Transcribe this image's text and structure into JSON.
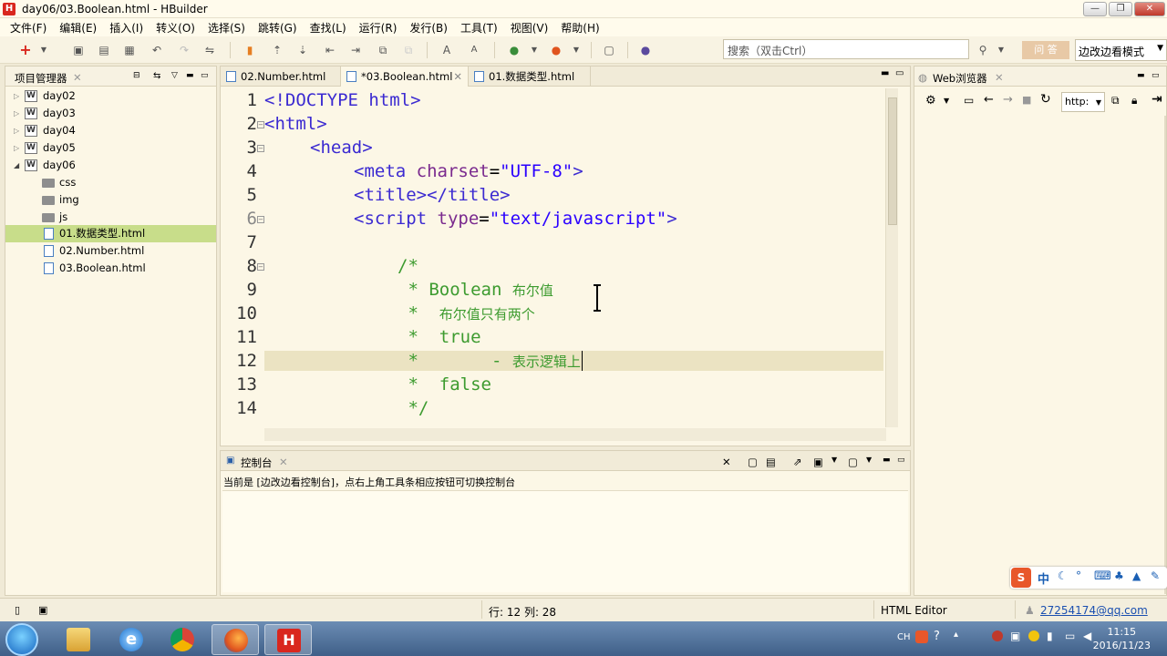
{
  "window": {
    "title": "day06/03.Boolean.html - HBuilder",
    "logo": "H",
    "controls": {
      "minimize": "—",
      "restore": "❐",
      "close": "✕"
    }
  },
  "menu": [
    "文件(F)",
    "编辑(E)",
    "插入(I)",
    "转义(O)",
    "选择(S)",
    "跳转(G)",
    "查找(L)",
    "运行(R)",
    "发行(B)",
    "工具(T)",
    "视图(V)",
    "帮助(H)"
  ],
  "toolbar": {
    "search_placeholder": "搜索（双击Ctrl）",
    "ask_label": "问 答",
    "mode_label": "边改边看模式"
  },
  "project_panel": {
    "title": "项目管理器",
    "items": [
      {
        "label": "day02",
        "type": "project"
      },
      {
        "label": "day03",
        "type": "project"
      },
      {
        "label": "day04",
        "type": "project"
      },
      {
        "label": "day05",
        "type": "project"
      },
      {
        "label": "day06",
        "type": "project"
      },
      {
        "label": "css",
        "type": "folder"
      },
      {
        "label": "img",
        "type": "folder"
      },
      {
        "label": "js",
        "type": "folder"
      },
      {
        "label": "01.数据类型.html",
        "type": "file",
        "selected": true
      },
      {
        "label": "02.Number.html",
        "type": "file"
      },
      {
        "label": "03.Boolean.html",
        "type": "file"
      }
    ]
  },
  "editor": {
    "tabs": [
      {
        "label": "02.Number.html",
        "active": false
      },
      {
        "label": "*03.Boolean.html",
        "active": true
      },
      {
        "label": "01.数据类型.html",
        "active": false
      }
    ],
    "line_numbers": [
      "1",
      "2",
      "3",
      "4",
      "5",
      "6",
      "7",
      "8",
      "9",
      "10",
      "11",
      "12",
      "13",
      "14"
    ],
    "code": {
      "l1": "<!DOCTYPE html>",
      "l2": "<html>",
      "l3": "<head>",
      "l4_tag": "<meta ",
      "l4_attr": "charset",
      "l4_eq": "=",
      "l4_val": "\"UTF-8\"",
      "l4_end": ">",
      "l5": "<title></title>",
      "l6_tag": "<script ",
      "l6_attr": "type",
      "l6_eq": "=",
      "l6_val": "\"text/javascript\"",
      "l6_end": ">",
      "l8": "/*",
      "l9_star": " * Boolean ",
      "l9_cn": "布尔值",
      "l10_star": " *  ",
      "l10_cn": "布尔值只有两个",
      "l11": " *  true",
      "l12_star": " *       - ",
      "l12_cn": "表示逻辑上",
      "l13": " *  false",
      "l14": " */"
    }
  },
  "console": {
    "title": "控制台",
    "message": "当前是 [边改边看控制台]，点右上角工具条相应按钮可切换控制台"
  },
  "browser_panel": {
    "title": "Web浏览器",
    "url": "http:"
  },
  "status": {
    "position": "行: 12 列: 28",
    "editor_type": "HTML Editor",
    "user": "27254174@qq.com"
  },
  "ime": {
    "label": "中"
  },
  "taskbar": {
    "time": "11:15",
    "date": "2016/11/23",
    "lang": "CH"
  }
}
